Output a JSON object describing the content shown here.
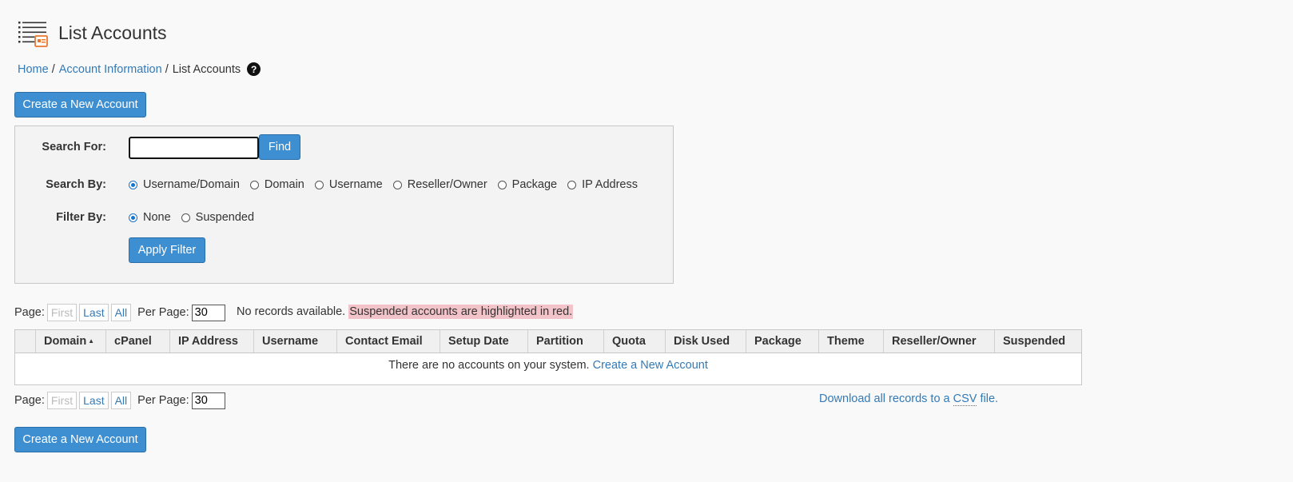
{
  "page": {
    "title": "List Accounts",
    "icon": "list-accounts-icon"
  },
  "breadcrumb": {
    "home": "Home",
    "account_information": "Account Information",
    "current": "List Accounts",
    "separator": "/",
    "help_glyph": "?"
  },
  "actions": {
    "create_label": "Create a New Account"
  },
  "search": {
    "search_for_label": "Search For:",
    "search_value": "",
    "find_label": "Find",
    "search_by_label": "Search By:",
    "search_by_options": [
      "Username/Domain",
      "Domain",
      "Username",
      "Reseller/Owner",
      "Package",
      "IP Address"
    ],
    "search_by_selected": "Username/Domain",
    "filter_by_label": "Filter By:",
    "filter_by_options": [
      "None",
      "Suspended"
    ],
    "filter_by_selected": "None",
    "apply_filter_label": "Apply Filter"
  },
  "pager": {
    "page_label": "Page:",
    "first": "First",
    "last": "Last",
    "all": "All",
    "per_page_label": "Per Page:",
    "per_page_value": "30"
  },
  "notice": {
    "no_records": "No records available.",
    "suspended_note": "Suspended accounts are highlighted in red."
  },
  "table": {
    "columns": [
      "",
      "Domain",
      "cPanel",
      "IP Address",
      "Username",
      "Contact Email",
      "Setup Date",
      "Partition",
      "Quota",
      "Disk Used",
      "Package",
      "Theme",
      "Reseller/Owner",
      "Suspended"
    ],
    "sorted_column": "Domain",
    "sort_direction": "asc",
    "empty_text": "There are no accounts on your system.",
    "empty_link": "Create a New Account"
  },
  "download": {
    "prefix": "Download all records to a",
    "abbr": "CSV",
    "suffix": "file."
  },
  "colors": {
    "primary_button": "#3d8fd1",
    "link": "#337ab7",
    "suspended_highlight": "#f2c3c8",
    "icon_accent": "#e8772e"
  }
}
